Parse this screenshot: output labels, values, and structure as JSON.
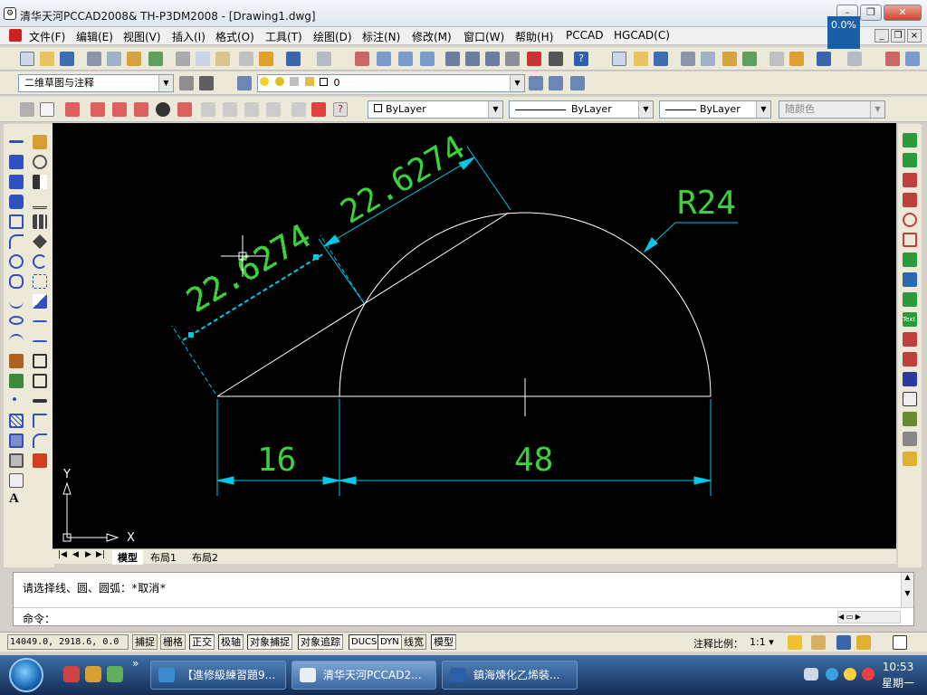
{
  "window": {
    "title": "清华天河PCCAD2008& TH-P3DM2008 - [Drawing1.dwg]",
    "app_icon": "pccad-app-icon",
    "progress": "0.0%"
  },
  "menu": [
    "文件(F)",
    "编辑(E)",
    "视图(V)",
    "插入(I)",
    "格式(O)",
    "工具(T)",
    "绘图(D)",
    "标注(N)",
    "修改(M)",
    "窗口(W)",
    "帮助(H)",
    "PCCAD",
    "HGCAD(C)"
  ],
  "workspace": {
    "value": "二维草图与注释"
  },
  "layer": {
    "value": "0"
  },
  "props": {
    "color": "ByLayer",
    "linetype": "ByLayer",
    "lineweight": "ByLayer",
    "plotstyle": "随颜色"
  },
  "drawing": {
    "dims": {
      "d1": "22.6274",
      "d2": "22.6274",
      "radius": "R24",
      "w1": "16",
      "w2": "48"
    },
    "ucs": {
      "x": "X",
      "y": "Y"
    },
    "colors": {
      "background": "#000000",
      "geometry": "#ffffff",
      "dimension": "#00c8e6",
      "text": "#3cd23c"
    }
  },
  "tabs": [
    "模型",
    "布局1",
    "布局2"
  ],
  "command": {
    "history": "请选择线、圆、圆弧：*取消*",
    "prompt": "命令："
  },
  "status": {
    "coords": "14049.0, 2918.6, 0.0",
    "toggles": [
      "捕捉",
      "栅格",
      "正交",
      "极轴",
      "对象捕捉",
      "对象追踪",
      "DUCS",
      "DYN",
      "线宽",
      "模型"
    ],
    "scale_label": "注释比例：",
    "scale_value": "1:1"
  },
  "taskbar": {
    "tasks": [
      "【進修級練習題9...",
      "清华天河PCCAD2...",
      "鎮海煉化乙烯裝..."
    ],
    "time": "10:53",
    "day": "星期一"
  }
}
